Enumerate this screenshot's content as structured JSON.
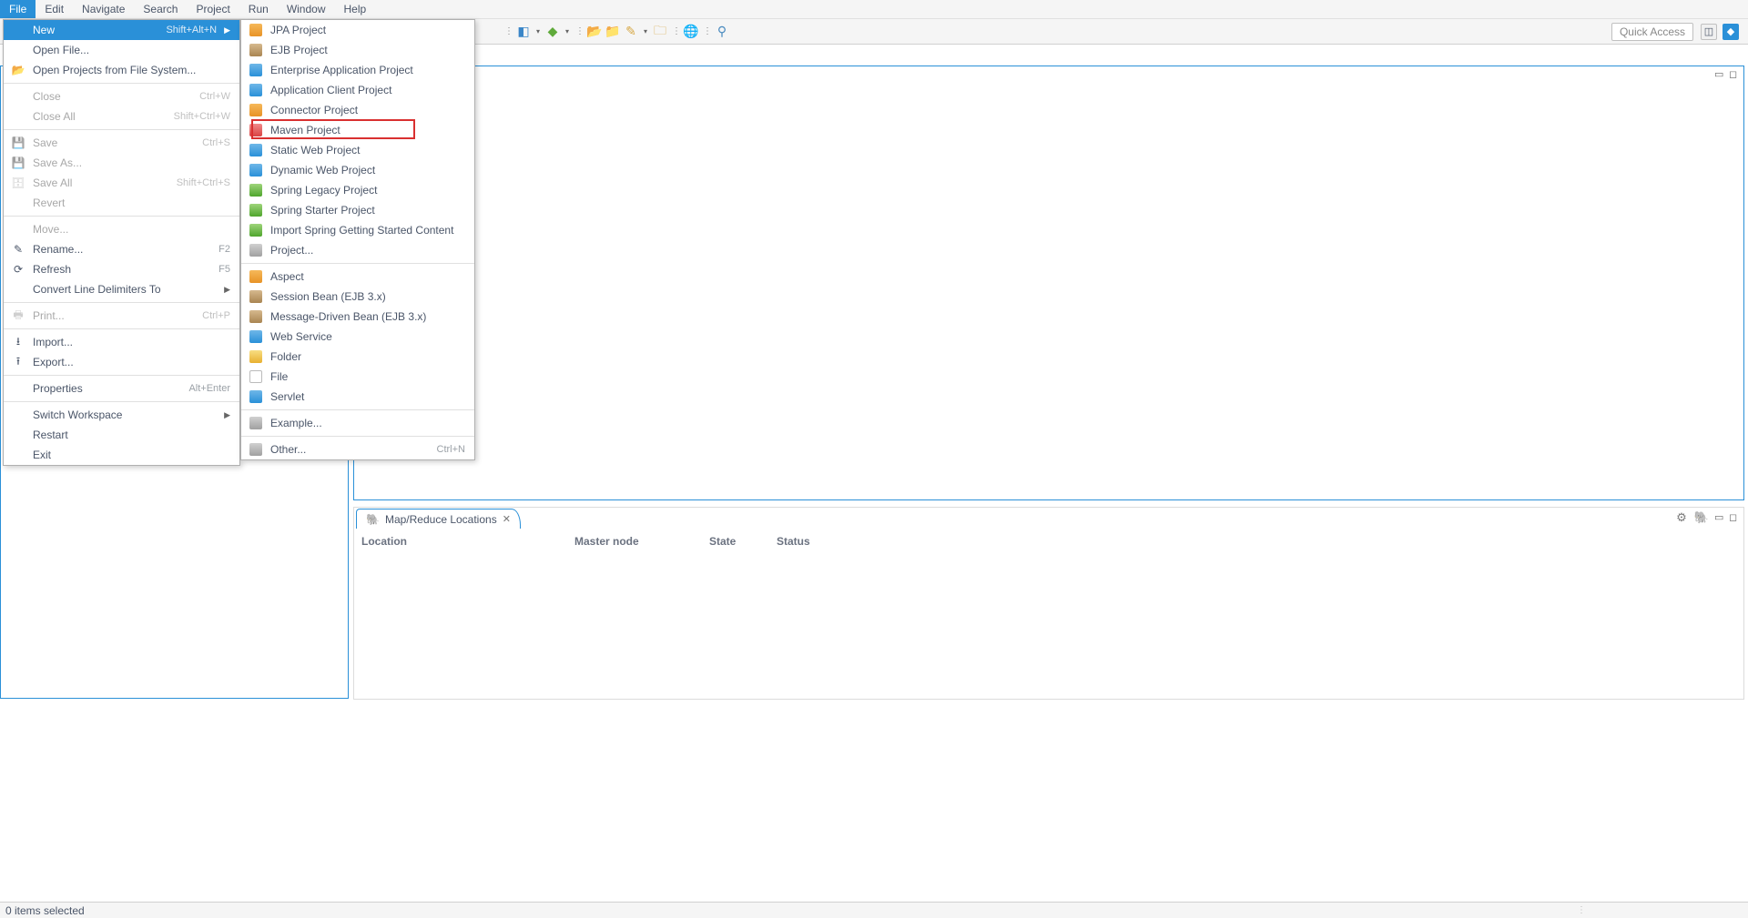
{
  "menubar": [
    "File",
    "Edit",
    "Navigate",
    "Search",
    "Project",
    "Run",
    "Window",
    "Help"
  ],
  "menubar_active_index": 0,
  "toolbar": {
    "quick_access": "Quick Access"
  },
  "file_menu": [
    {
      "label": "New",
      "shortcut": "Shift+Alt+N",
      "selected": true,
      "submenu": true
    },
    {
      "label": "Open File..."
    },
    {
      "icon": "folder",
      "label": "Open Projects from File System..."
    },
    {
      "sep": true
    },
    {
      "label": "Close",
      "shortcut": "Ctrl+W",
      "disabled": true
    },
    {
      "label": "Close All",
      "shortcut": "Shift+Ctrl+W",
      "disabled": true
    },
    {
      "sep": true
    },
    {
      "icon": "save",
      "label": "Save",
      "shortcut": "Ctrl+S",
      "disabled": true
    },
    {
      "icon": "saveas",
      "label": "Save As...",
      "disabled": true
    },
    {
      "icon": "saveall",
      "label": "Save All",
      "shortcut": "Shift+Ctrl+S",
      "disabled": true
    },
    {
      "label": "Revert",
      "disabled": true
    },
    {
      "sep": true
    },
    {
      "label": "Move...",
      "disabled": true
    },
    {
      "icon": "rename",
      "label": "Rename...",
      "shortcut": "F2"
    },
    {
      "icon": "refresh",
      "label": "Refresh",
      "shortcut": "F5"
    },
    {
      "label": "Convert Line Delimiters To",
      "submenu": true
    },
    {
      "sep": true
    },
    {
      "icon": "print",
      "label": "Print...",
      "shortcut": "Ctrl+P",
      "disabled": true
    },
    {
      "sep": true
    },
    {
      "icon": "import",
      "label": "Import..."
    },
    {
      "icon": "export",
      "label": "Export..."
    },
    {
      "sep": true
    },
    {
      "label": "Properties",
      "shortcut": "Alt+Enter"
    },
    {
      "sep": true
    },
    {
      "label": "Switch Workspace",
      "submenu": true
    },
    {
      "label": "Restart"
    },
    {
      "label": "Exit"
    }
  ],
  "new_menu": [
    {
      "icon": "pi-orange",
      "label": "JPA Project"
    },
    {
      "icon": "pi-brown",
      "label": "EJB Project"
    },
    {
      "icon": "pi-blue",
      "label": "Enterprise Application Project"
    },
    {
      "icon": "pi-blue",
      "label": "Application Client Project"
    },
    {
      "icon": "pi-orange",
      "label": "Connector Project"
    },
    {
      "icon": "pi-red",
      "label": "Maven Project",
      "highlight": true
    },
    {
      "icon": "pi-blue",
      "label": "Static Web Project"
    },
    {
      "icon": "pi-blue",
      "label": "Dynamic Web Project"
    },
    {
      "icon": "pi-green",
      "label": "Spring Legacy Project"
    },
    {
      "icon": "pi-green",
      "label": "Spring Starter Project"
    },
    {
      "icon": "pi-green",
      "label": "Import Spring Getting Started Content"
    },
    {
      "icon": "pi-gray",
      "label": "Project..."
    },
    {
      "sep": true
    },
    {
      "icon": "pi-orange",
      "label": "Aspect"
    },
    {
      "icon": "pi-brown",
      "label": "Session Bean (EJB 3.x)"
    },
    {
      "icon": "pi-brown",
      "label": "Message-Driven Bean (EJB 3.x)"
    },
    {
      "icon": "pi-blue",
      "label": "Web Service"
    },
    {
      "icon": "pi-folder",
      "label": "Folder"
    },
    {
      "icon": "pi-file",
      "label": "File"
    },
    {
      "icon": "pi-blue",
      "label": "Servlet"
    },
    {
      "sep": true
    },
    {
      "icon": "pi-gray",
      "label": "Example..."
    },
    {
      "sep": true
    },
    {
      "icon": "pi-gray",
      "label": "Other...",
      "shortcut": "Ctrl+N"
    }
  ],
  "bottom_panel": {
    "tab_label": "Map/Reduce Locations",
    "columns": [
      "Location",
      "Master node",
      "State",
      "Status"
    ]
  },
  "statusbar": {
    "text": "0 items selected"
  }
}
